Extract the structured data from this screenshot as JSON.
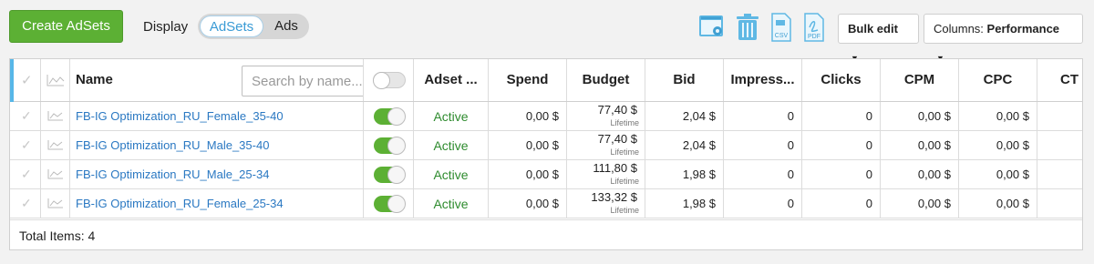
{
  "toolbar": {
    "create_label": "Create AdSets",
    "display_label": "Display",
    "display_options": [
      {
        "label": "AdSets",
        "selected": true
      },
      {
        "label": "Ads",
        "selected": false
      }
    ],
    "icons": [
      "settings-icon",
      "trash-icon",
      "csv-export-icon",
      "pdf-export-icon"
    ],
    "csv_label": "CSV",
    "pdf_label": "PDF",
    "bulk_edit_label": "Bulk edit",
    "columns_prefix": "Columns:",
    "columns_value": "Performance"
  },
  "table": {
    "columns": {
      "name": "Name",
      "status": "Adset ...",
      "spend": "Spend",
      "budget": "Budget",
      "bid": "Bid",
      "impressions": "Impress...",
      "clicks": "Clicks",
      "cpm": "CPM",
      "cpc": "CPC",
      "ctr": "CT"
    },
    "search_placeholder": "Search by name...",
    "rows": [
      {
        "name": "FB-IG Optimization_RU_Female_35-40",
        "status": "Active",
        "spend": "0,00 $",
        "budget": "77,40 $",
        "budget_sub": "Lifetime",
        "bid": "2,04 $",
        "impressions": "0",
        "clicks": "0",
        "cpm": "0,00 $",
        "cpc": "0,00 $"
      },
      {
        "name": "FB-IG Optimization_RU_Male_35-40",
        "status": "Active",
        "spend": "0,00 $",
        "budget": "77,40 $",
        "budget_sub": "Lifetime",
        "bid": "2,04 $",
        "impressions": "0",
        "clicks": "0",
        "cpm": "0,00 $",
        "cpc": "0,00 $"
      },
      {
        "name": "FB-IG Optimization_RU_Male_25-34",
        "status": "Active",
        "spend": "0,00 $",
        "budget": "111,80 $",
        "budget_sub": "Lifetime",
        "bid": "1,98 $",
        "impressions": "0",
        "clicks": "0",
        "cpm": "0,00 $",
        "cpc": "0,00 $"
      },
      {
        "name": "FB-IG Optimization_RU_Female_25-34",
        "status": "Active",
        "spend": "0,00 $",
        "budget": "133,32 $",
        "budget_sub": "Lifetime",
        "bid": "1,98 $",
        "impressions": "0",
        "clicks": "0",
        "cpm": "0,00 $",
        "cpc": "0,00 $"
      }
    ],
    "footer": "Total Items: 4"
  },
  "colors": {
    "accent_green": "#5cb034",
    "accent_blue": "#3a9bd5",
    "link": "#2a78c2",
    "active_status": "#2e8b2e"
  }
}
